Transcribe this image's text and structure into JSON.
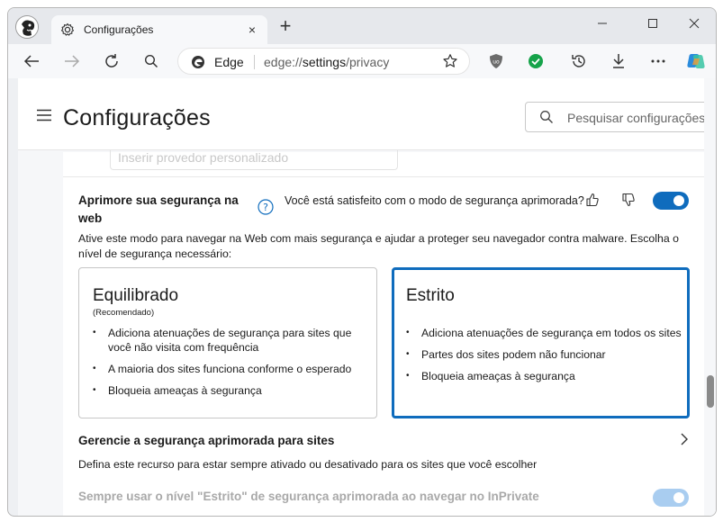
{
  "tab": {
    "title": "Configurações",
    "close": "×"
  },
  "new_tab": "+",
  "window_controls": {
    "minimize": "—",
    "maximize": "☐",
    "close": "✕"
  },
  "address": {
    "site": "Edge",
    "url_prefix": "edge://",
    "url_bold": "settings",
    "url_suffix": "/privacy"
  },
  "header": {
    "title": "Configurações",
    "search_placeholder": "Pesquisar configurações"
  },
  "previous_field": {
    "value": "Inserir provedor personalizado"
  },
  "security": {
    "title": "Aprimore sua segurança na web",
    "satisfied_question": "Você está satisfeito com o modo de segurança aprimorada?",
    "enabled": true,
    "description": "Ative este modo para navegar na Web com mais segurança e ajudar a proteger seu navegador contra malware. Escolha o nível de segurança necessário:",
    "options": [
      {
        "title": "Equilibrado",
        "subtitle": "(Recomendado)",
        "selected": false,
        "bullets": [
          "Adiciona atenuações de segurança para sites que você não visita com frequência",
          "A maioria dos sites funciona conforme o esperado",
          "Bloqueia ameaças à segurança"
        ]
      },
      {
        "title": "Estrito",
        "selected": true,
        "bullets": [
          "Adiciona atenuações de segurança em todos os sites",
          "Partes dos sites podem não funcionar",
          "Bloqueia ameaças à segurança"
        ]
      }
    ]
  },
  "manage": {
    "title": "Gerencie a segurança aprimorada para sites",
    "description": "Defina este recurso para estar sempre ativado ou desativado para os sites que você escolher"
  },
  "inprivate": {
    "label": "Sempre usar o nível \"Estrito\" de segurança aprimorada ao navegar no InPrivate",
    "enabled": true,
    "disabled": true
  },
  "colors": {
    "accent": "#0f6cbd",
    "accent_disabled": "#a9cdf0"
  }
}
